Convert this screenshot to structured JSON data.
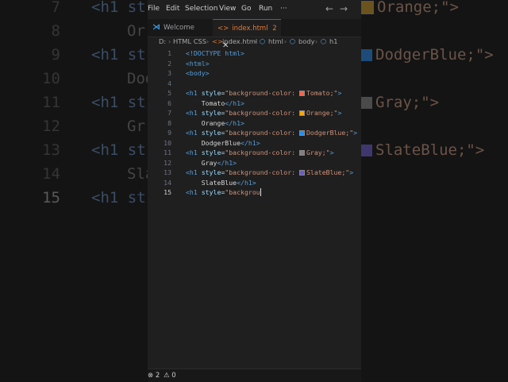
{
  "menu": [
    "File",
    "Edit",
    "Selection",
    "View",
    "Go",
    "Run",
    "···"
  ],
  "tabs": [
    {
      "label": "Welcome",
      "icon": "vscode-icon"
    },
    {
      "label": "index.html",
      "badge": "2",
      "icon": "html-icon"
    }
  ],
  "breadcrumb": [
    "D:",
    "HTML CSS",
    "index.html",
    "html",
    "body",
    "h1"
  ],
  "editor": {
    "line_numbers": [
      "1",
      "2",
      "3",
      "4",
      "5",
      "6",
      "7",
      "8",
      "9",
      "10",
      "11",
      "12",
      "13",
      "14",
      "15"
    ],
    "lines": [
      "<!DOCTYPE html>",
      "<html>",
      "<body>",
      "",
      "<h1 style=\"background-color: Tomato;\">",
      "    Tomato</h1>",
      "<h1 style=\"background-color: Orange;\">",
      "    Orange</h1>",
      "<h1 style=\"background-color: DodgerBlue;\">",
      "    DodgerBlue</h1>",
      "<h1 style=\"background-color: Gray;\">",
      "    Gray</h1>",
      "<h1 style=\"background-color: SlateBlue;\">",
      "    SlateBlue</h1>",
      "<h1 style=\"backgrou"
    ],
    "swatches": {
      "Tomato": "#ff6347",
      "Orange": "#ffa500",
      "DodgerBlue": "#1e90ff",
      "Gray": "#808080",
      "SlateBlue": "#6a5acd"
    }
  },
  "background": {
    "line_numbers": [
      "7",
      "8",
      "9",
      "10",
      "11",
      "12",
      "13",
      "14",
      "15"
    ],
    "left_lines": [
      "<h1 st",
      "Or",
      "<h1 st",
      "Dod",
      "<h1 st",
      "Gr",
      "<h1 st",
      "Sla",
      "<h1 st"
    ],
    "right_lines": [
      "Orange;\">",
      "DodgerBlue;\">",
      "Gray;\">",
      "SlateBlue;\">"
    ]
  },
  "status": {
    "errors": "2",
    "warnings": "0"
  },
  "colors": {
    "accent": "#0078d4",
    "tab_active_text": "#e37933"
  }
}
